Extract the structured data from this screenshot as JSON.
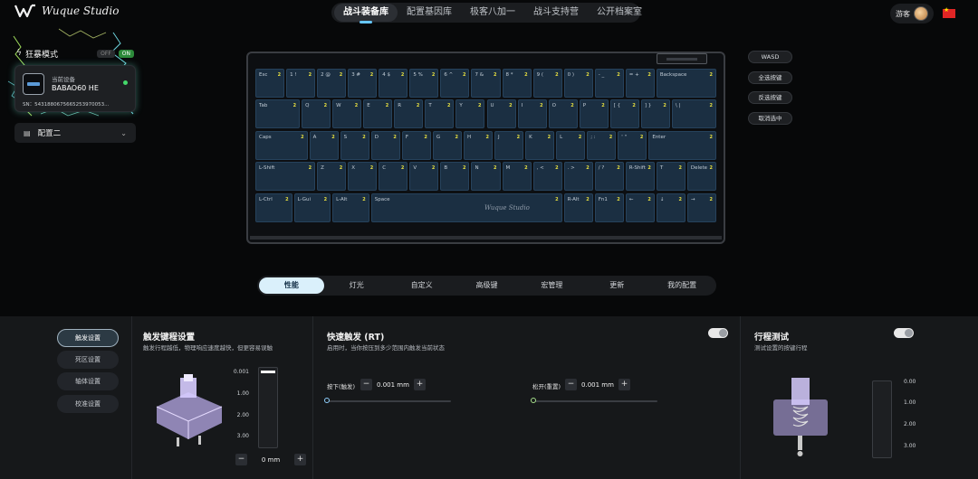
{
  "header": {
    "logo_text": "Wuque Studio",
    "tabs": [
      {
        "label": "战斗装备库",
        "active": true
      },
      {
        "label": "配置基因库",
        "active": false
      },
      {
        "label": "极客八加一",
        "active": false
      },
      {
        "label": "战斗支持营",
        "active": false
      },
      {
        "label": "公开档案室",
        "active": false
      }
    ],
    "user_label": "游客"
  },
  "left_panel": {
    "mode_label": "狂暴模式",
    "toggle_off": "OFF",
    "toggle_on": "ON",
    "device_caption": "当前设备",
    "device_name": "BABAO60 HE",
    "sn": "SN：5431880675665253970053...",
    "config_label": "配置二"
  },
  "keyboard": {
    "brand": "Wuque Studio",
    "badge": "2",
    "rows": [
      [
        [
          "Esc",
          1
        ],
        [
          "1 !",
          1
        ],
        [
          "2 @",
          1
        ],
        [
          "3 #",
          1
        ],
        [
          "4 $",
          1
        ],
        [
          "5 %",
          1
        ],
        [
          "6 ^",
          1
        ],
        [
          "7 &",
          1
        ],
        [
          "8 *",
          1
        ],
        [
          "9 (",
          1
        ],
        [
          "0 )",
          1
        ],
        [
          "- _",
          1
        ],
        [
          "= +",
          1
        ],
        [
          "Backspace",
          2
        ]
      ],
      [
        [
          "Tab",
          1.5
        ],
        [
          "Q",
          1
        ],
        [
          "W",
          1
        ],
        [
          "E",
          1
        ],
        [
          "R",
          1
        ],
        [
          "T",
          1
        ],
        [
          "Y",
          1
        ],
        [
          "U",
          1
        ],
        [
          "I",
          1
        ],
        [
          "O",
          1
        ],
        [
          "P",
          1
        ],
        [
          "[ {",
          1
        ],
        [
          "] }",
          1
        ],
        [
          "\\ |",
          1.5
        ]
      ],
      [
        [
          "Caps",
          1.75
        ],
        [
          "A",
          1
        ],
        [
          "S",
          1
        ],
        [
          "D",
          1
        ],
        [
          "F",
          1
        ],
        [
          "G",
          1
        ],
        [
          "H",
          1
        ],
        [
          "J",
          1
        ],
        [
          "K",
          1
        ],
        [
          "L",
          1
        ],
        [
          "; :",
          1
        ],
        [
          "' \"",
          1
        ],
        [
          "Enter",
          2.25
        ]
      ],
      [
        [
          "L-Shift",
          2
        ],
        [
          "Z",
          1
        ],
        [
          "X",
          1
        ],
        [
          "C",
          1
        ],
        [
          "V",
          1
        ],
        [
          "B",
          1
        ],
        [
          "N",
          1
        ],
        [
          "M",
          1
        ],
        [
          ", <",
          1
        ],
        [
          ". >",
          1
        ],
        [
          "/ ?",
          1
        ],
        [
          "R-Shift",
          1
        ],
        [
          "T",
          1
        ],
        [
          "Delete",
          1
        ]
      ],
      [
        [
          "L-Ctrl",
          1.25
        ],
        [
          "L-Gui",
          1.25
        ],
        [
          "L-Alt",
          1.25
        ],
        [
          "Space",
          6.25
        ],
        [
          "R-Alt",
          1
        ],
        [
          "Fn1",
          1
        ],
        [
          "←",
          1
        ],
        [
          "↓",
          1
        ],
        [
          "→",
          1
        ]
      ]
    ]
  },
  "side_buttons": [
    "WASD",
    "全选按键",
    "反选按键",
    "取消选中"
  ],
  "function_tabs": [
    {
      "label": "性能",
      "active": true
    },
    {
      "label": "灯光",
      "active": false
    },
    {
      "label": "自定义",
      "active": false
    },
    {
      "label": "高级键",
      "active": false
    },
    {
      "label": "宏管理",
      "active": false
    },
    {
      "label": "更新",
      "active": false
    },
    {
      "label": "我的配置",
      "active": false
    }
  ],
  "sub_nav": [
    {
      "label": "触发设置",
      "active": true
    },
    {
      "label": "死区设置",
      "active": false
    },
    {
      "label": "轴体设置",
      "active": false
    },
    {
      "label": "校准设置",
      "active": false
    }
  ],
  "trigger": {
    "title": "触发键程设置",
    "desc": "触发行程越低，物理响应速度越快，但更容易误触",
    "ticks": [
      "0.001",
      "1.00",
      "2.00",
      "3.00"
    ],
    "value": "0 mm"
  },
  "rapid": {
    "title": "快速触发 (RT)",
    "desc": "启用时，当你按压到多少范围内触发当前状态",
    "press_label": "按下(触发)",
    "press_value": "0.001 mm",
    "release_label": "松开(重置)",
    "release_value": "0.001 mm",
    "enabled": true
  },
  "travel": {
    "title": "行程测试",
    "desc": "测试设置的按键行程",
    "ticks": [
      "0.00",
      "1.00",
      "2.00",
      "3.00"
    ],
    "enabled": true
  },
  "colors": {
    "accent": "#66c6ff",
    "key_fill": "#1b2f42",
    "badge": "#e8e040",
    "active_tab": "#daf0fb"
  }
}
